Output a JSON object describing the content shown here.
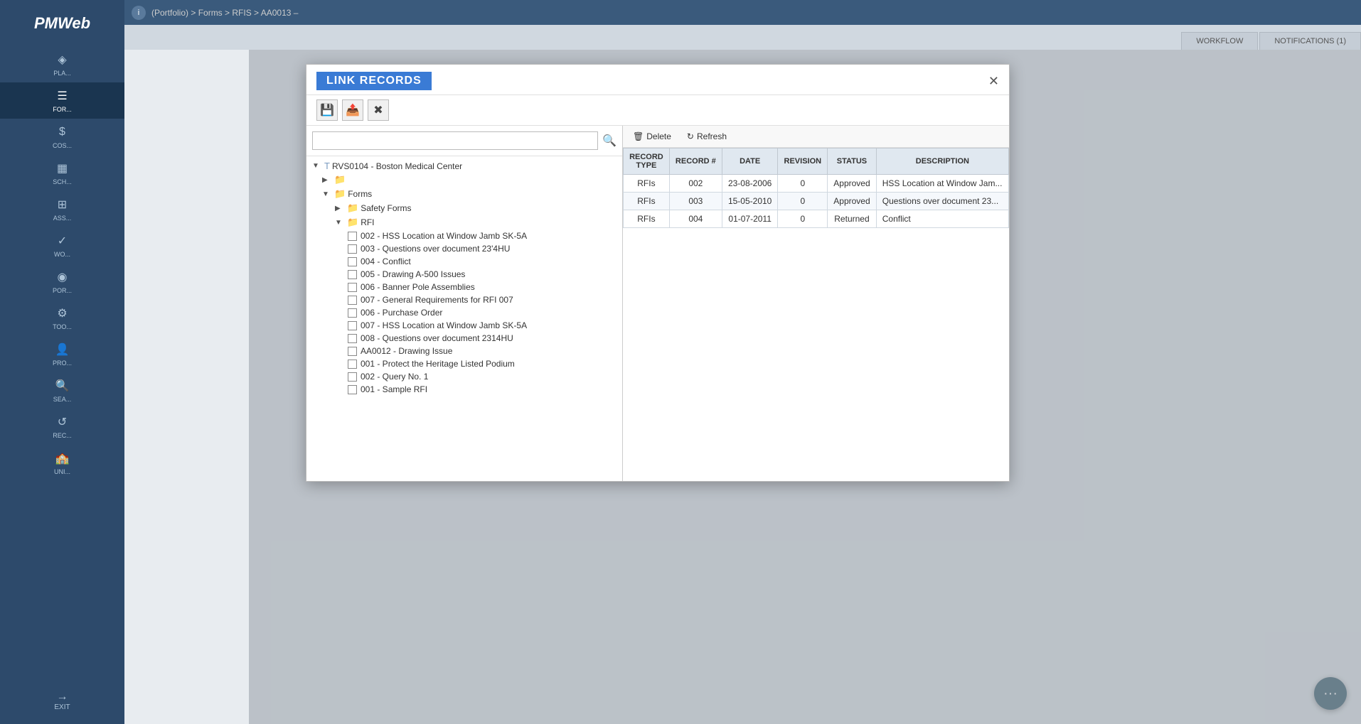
{
  "app": {
    "logo": "PMWeb",
    "topbar": {
      "breadcrumb": "(Portfolio) > Forms > RFIS > AA0013 –"
    }
  },
  "sidebar": {
    "items": [
      {
        "id": "plan",
        "label": "PLA...",
        "icon": "◈"
      },
      {
        "id": "forms",
        "label": "FOR...",
        "icon": "☰",
        "active": true
      },
      {
        "id": "cost",
        "label": "COS...",
        "icon": "$"
      },
      {
        "id": "schedule",
        "label": "SCH...",
        "icon": "📅"
      },
      {
        "id": "assets",
        "label": "ASS...",
        "icon": "⊞"
      },
      {
        "id": "workflow",
        "label": "WO...",
        "icon": "✓"
      },
      {
        "id": "portfolio",
        "label": "POR...",
        "icon": "◉"
      },
      {
        "id": "tools",
        "label": "TOO...",
        "icon": "⚙"
      },
      {
        "id": "project",
        "label": "PRO...",
        "icon": "👤"
      },
      {
        "id": "search",
        "label": "SEA...",
        "icon": "🔍"
      },
      {
        "id": "records",
        "label": "REC...",
        "icon": "↺"
      },
      {
        "id": "uni",
        "label": "UNI...",
        "icon": "🏫"
      },
      {
        "id": "exit",
        "label": "EXIT",
        "icon": "→"
      }
    ]
  },
  "main": {
    "tabs": [
      {
        "id": "workflow",
        "label": "WORKFLOW",
        "active": false
      },
      {
        "id": "notifications",
        "label": "NOTIFICATIONS (1)",
        "active": false
      }
    ]
  },
  "modal": {
    "title": "LINK RECORDS",
    "toolbar": {
      "save_label": "Save",
      "export_label": "Export",
      "close_label": "Close"
    },
    "tree": {
      "search_placeholder": "",
      "root": {
        "label": "RVS0104 - Boston Medical Center",
        "children": [
          {
            "label": "Forms",
            "expanded": true,
            "children": [
              {
                "label": "Safety Forms",
                "expanded": false,
                "children": []
              },
              {
                "label": "RFI",
                "expanded": true,
                "items": [
                  "002 - HSS Location at Window Jamb SK-5A",
                  "003 - Questions over document 23'4HU",
                  "004 - Conflict",
                  "005 - Drawing A-500 Issues",
                  "006 - Banner Pole Assemblies",
                  "007 - General Requirements for RFI 007",
                  "006 - Purchase Order",
                  "007 - HSS Location at Window Jamb SK-5A",
                  "008 - Questions over document 2314HU",
                  "AA0012 - Drawing Issue",
                  "001 - Protect the Heritage Listed Podium",
                  "002 - Query No. 1",
                  "001 - Sample RFI"
                ]
              }
            ]
          }
        ]
      }
    },
    "records": {
      "toolbar": {
        "delete_label": "Delete",
        "refresh_label": "Refresh"
      },
      "columns": [
        "RECORD TYPE",
        "RECORD #",
        "DATE",
        "REVISION",
        "STATUS",
        "DESCRIPTION"
      ],
      "rows": [
        {
          "record_type": "RFIs",
          "record_num": "002",
          "date": "23-08-2006",
          "revision": "0",
          "status": "Approved",
          "description": "HSS Location at Window Jam..."
        },
        {
          "record_type": "RFIs",
          "record_num": "003",
          "date": "15-05-2010",
          "revision": "0",
          "status": "Approved",
          "description": "Questions over document 23..."
        },
        {
          "record_type": "RFIs",
          "record_num": "004",
          "date": "01-07-2011",
          "revision": "0",
          "status": "Returned",
          "description": "Conflict"
        }
      ]
    }
  },
  "fab": {
    "icon": "···"
  }
}
